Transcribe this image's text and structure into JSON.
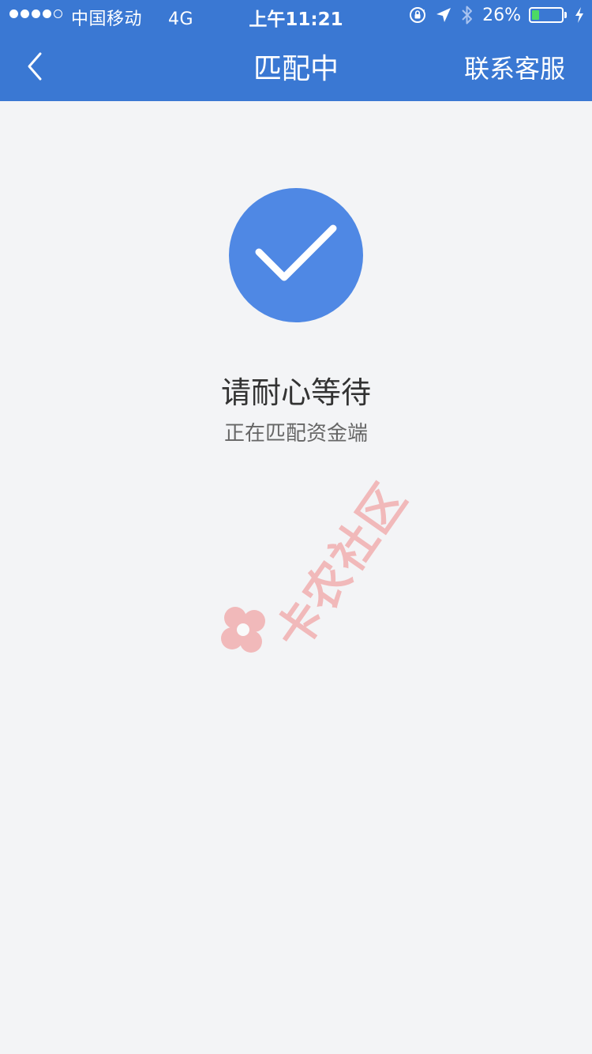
{
  "status_bar": {
    "signal_dots": 5,
    "signal_filled": 4,
    "carrier": "中国移动",
    "network": "4G",
    "time": "上午11:21",
    "battery_text": "26%",
    "battery_level": 0.26,
    "battery_color": "#4cd964",
    "icons": [
      "orientation-lock-icon",
      "location-arrow-icon",
      "bluetooth-icon",
      "charging-bolt-icon"
    ]
  },
  "nav": {
    "back_icon": "chevron-left-icon",
    "title": "匹配中",
    "action_label": "联系客服",
    "background_color": "#3a78d3"
  },
  "main": {
    "status_icon": "checkmark-icon",
    "status_icon_color": "#4f88e4",
    "heading": "请耐心等待",
    "subtext": "正在匹配资金端"
  },
  "watermark": {
    "text": "卡农社区",
    "logo_icon": "flower-logo-icon"
  }
}
